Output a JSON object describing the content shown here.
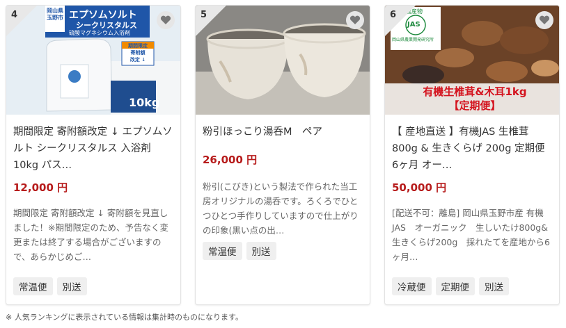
{
  "cards": [
    {
      "rank": "4",
      "image_text": {
        "origin": "岡山県\n玉野市",
        "brand": "エプソムソルト",
        "brand2": "シークリスタルス",
        "subtitle": "硫酸マグネシウム入浴剤",
        "badge": "期間限定\n寄附額\n改定 ↓",
        "weight": "10kg"
      },
      "title": "期間限定 寄附額改定 ↓ エプソムソルト シークリスタルス 入浴剤 10kg パス…",
      "price": "12,000 円",
      "description": "期間限定 寄附額改定 ↓ 寄附額を見直しました！※期間限定のため、予告なく変更または終了する場合がございますので、あらかじめご…",
      "tags": [
        "常温便",
        "別送"
      ]
    },
    {
      "rank": "5",
      "title": "粉引ほっこり湯呑M　ペア",
      "price": "26,000 円",
      "description": "粉引(こびき)という製法で作られた当工房オリジナルの湯呑です。ろくろでひとつひとつ手作りしていますので仕上がりの印象(黒い点の出…",
      "tags": [
        "常温便",
        "別送"
      ]
    },
    {
      "rank": "6",
      "image_text": {
        "seal_top": "農産物",
        "seal_mark": "JAS",
        "seal_bottom": "岡山県農業開発研究所",
        "banner": "有機生椎茸&木耳1kg\n【定期便】"
      },
      "title": "【 産地直送 】有機JAS 生椎茸 800g & 生きくらげ 200g 定期便 6ヶ月 オー…",
      "price": "50,000 円",
      "description": "[配送不可：離島] 岡山県玉野市産 有機JAS　オーガニック　生しいたけ800g&生きくらげ200g　採れたてを産地から6ヶ月…",
      "tags": [
        "冷蔵便",
        "定期便",
        "別送"
      ]
    }
  ],
  "footnote": "※ 人気ランキングに表示されている情報は集計時のものになります。",
  "icons": {
    "favorite": "heart-icon"
  },
  "colors": {
    "price": "#b71c1c",
    "tag_bg": "#efefef",
    "rank_bg": "#e8e8e8"
  }
}
